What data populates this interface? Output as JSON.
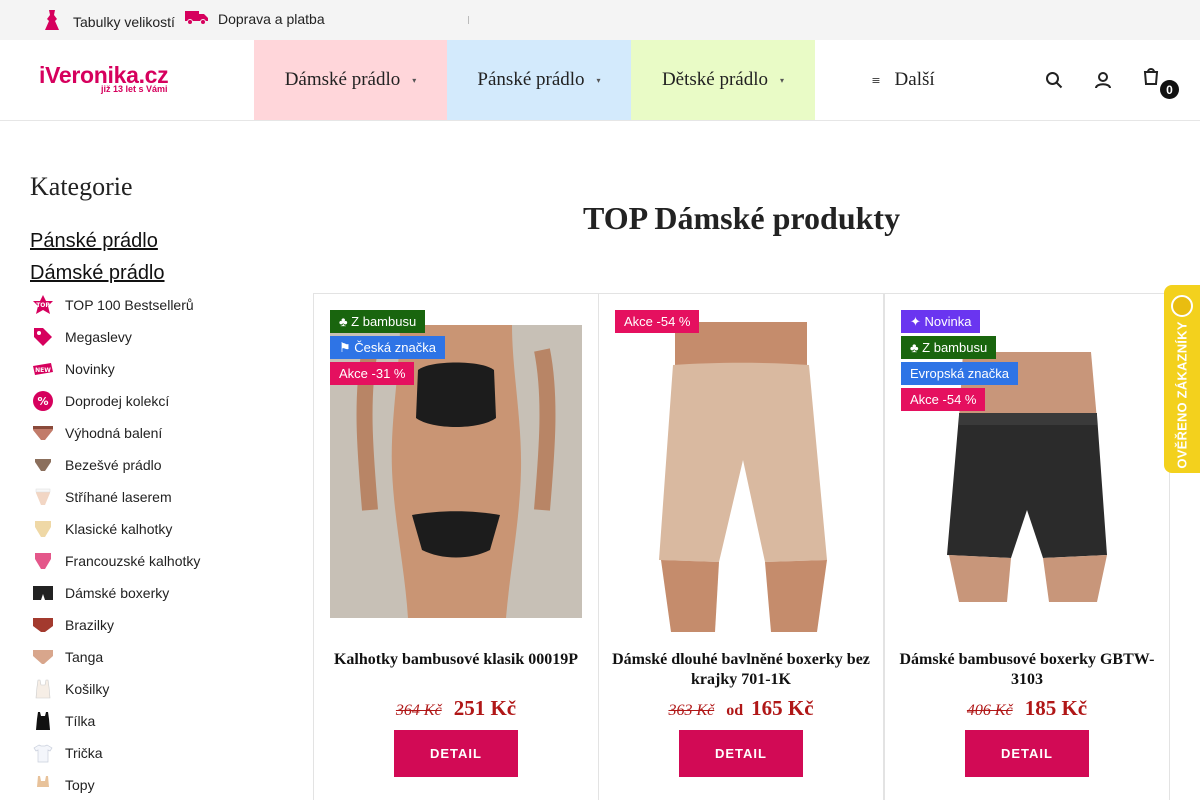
{
  "topbar": {
    "size_tables": "Tabulky velikostí",
    "shipping": "Doprava a platba"
  },
  "logo": {
    "name": "iVeronika.cz",
    "tagline": "již 13 let s Vámi"
  },
  "nav": {
    "items": [
      {
        "label": "Dámské prádlo",
        "color": "#ffd6da"
      },
      {
        "label": "Pánské prádlo",
        "color": "#d3eafc"
      },
      {
        "label": "Dětské prádlo",
        "color": "#e9fbc6"
      },
      {
        "label": "Další"
      }
    ],
    "cart_count": "0"
  },
  "sidebar": {
    "title": "Kategorie",
    "main_links": [
      "Pánské prádlo",
      "Dámské prádlo"
    ],
    "items": [
      {
        "label": "TOP 100 Bestsellerů",
        "icon": "top-icon"
      },
      {
        "label": "Megaslevy",
        "icon": "price-tag-icon"
      },
      {
        "label": "Novinky",
        "icon": "new-icon"
      },
      {
        "label": "Doprodej kolekcí",
        "icon": "percent-icon"
      },
      {
        "label": "Výhodná balení",
        "icon": "briefs-icon"
      },
      {
        "label": "Bezešvé prádlo",
        "icon": "seamless-icon"
      },
      {
        "label": "Stříhané laserem",
        "icon": "laser-cut-icon"
      },
      {
        "label": "Klasické kalhotky",
        "icon": "classic-panties-icon"
      },
      {
        "label": "Francouzské kalhotky",
        "icon": "french-panties-icon"
      },
      {
        "label": "Dámské boxerky",
        "icon": "boxers-icon"
      },
      {
        "label": "Brazilky",
        "icon": "brazilian-icon"
      },
      {
        "label": "Tanga",
        "icon": "thong-icon"
      },
      {
        "label": "Košilky",
        "icon": "camisole-icon"
      },
      {
        "label": "Tílka",
        "icon": "tank-top-icon"
      },
      {
        "label": "Trička",
        "icon": "tshirt-icon"
      },
      {
        "label": "Topy",
        "icon": "top-garment-icon"
      }
    ]
  },
  "main": {
    "title": "TOP Dámské produkty"
  },
  "products": [
    {
      "badges": [
        {
          "text": "Z bambusu",
          "style": "green"
        },
        {
          "text": "Česká značka",
          "style": "blue"
        },
        {
          "text": "Akce -31 %",
          "style": "red"
        }
      ],
      "name": "Kalhotky bambusové klasik 00019P",
      "old_price": "364 Kč",
      "prefix": "",
      "price": "251 Kč",
      "button": "DETAIL"
    },
    {
      "badges": [
        {
          "text": "Akce -54 %",
          "style": "red"
        }
      ],
      "name": "Dámské dlouhé bavlněné boxerky bez krajky 701-1K",
      "old_price": "363 Kč",
      "prefix": "od",
      "price": "165 Kč",
      "button": "DETAIL"
    },
    {
      "badges": [
        {
          "text": "Novinka",
          "style": "purple"
        },
        {
          "text": "Z bambusu",
          "style": "green"
        },
        {
          "text": "Evropská značka",
          "style": "blue"
        },
        {
          "text": "Akce -54 %",
          "style": "red"
        }
      ],
      "name": "Dámské bambusové boxerky GBTW-3103",
      "old_price": "406 Kč",
      "prefix": "",
      "price": "185 Kč",
      "button": "DETAIL"
    }
  ],
  "verified_tab": {
    "label": "OVĚŘENO ZÁKAZNÍKY"
  }
}
